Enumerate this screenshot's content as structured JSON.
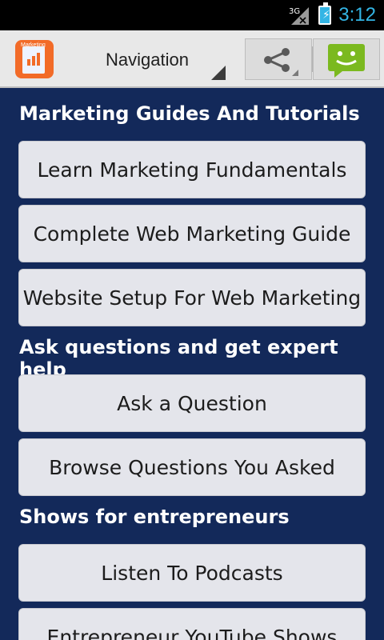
{
  "status_bar": {
    "network": "3G",
    "time": "3:12"
  },
  "action_bar": {
    "app_icon_label": "Marketing",
    "navigation": "Navigation"
  },
  "sections": [
    {
      "title": "Marketing Guides And Tutorials",
      "buttons": [
        "Learn Marketing Fundamentals",
        "Complete Web Marketing Guide",
        "Website Setup For Web Marketing"
      ]
    },
    {
      "title": "Ask questions and get expert help",
      "buttons": [
        "Ask a Question",
        "Browse Questions You Asked"
      ]
    },
    {
      "title": "Shows for entrepreneurs",
      "buttons": [
        "Listen To Podcasts",
        "Entrepreneur YouTube Shows"
      ]
    }
  ],
  "colors": {
    "background": "#13295a",
    "button": "#e4e5eb",
    "chat_green": "#7bb91f",
    "status_accent": "#33b5e5"
  }
}
